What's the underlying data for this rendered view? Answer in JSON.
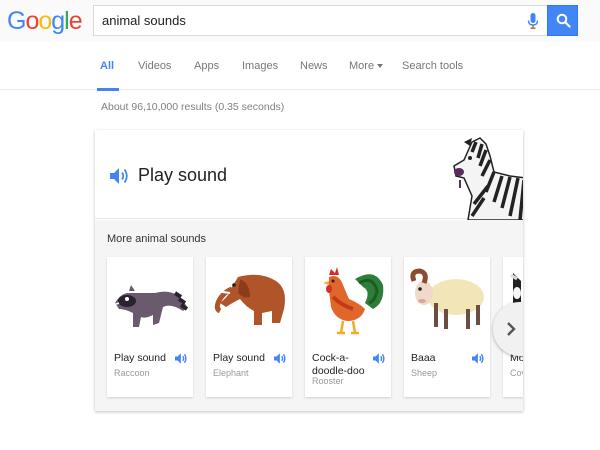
{
  "logo": {
    "letters": [
      "G",
      "o",
      "o",
      "g",
      "l",
      "e"
    ],
    "colors": [
      "#4285f4",
      "#ea4335",
      "#fbbc05",
      "#4285f4",
      "#34a853",
      "#ea4335"
    ]
  },
  "search": {
    "query": "animal sounds",
    "mic_icon": "microphone-icon",
    "button_icon": "search-icon"
  },
  "tabs": [
    {
      "label": "All",
      "active": true
    },
    {
      "label": "Videos"
    },
    {
      "label": "Apps"
    },
    {
      "label": "Images"
    },
    {
      "label": "News"
    },
    {
      "label": "More"
    },
    {
      "label": "Search tools"
    }
  ],
  "result_stats": "About 96,10,000 results (0.35 seconds)",
  "card": {
    "play_label": "Play sound",
    "speaker_icon": "speaker-icon",
    "more_title": "More animal sounds",
    "animals": [
      {
        "label": "Play sound",
        "sub": "Raccoon",
        "icon": "raccoon"
      },
      {
        "label": "Play sound",
        "sub": "Elephant",
        "icon": "elephant"
      },
      {
        "label_line1": "Cock-a-",
        "label_line2": "doodle-doo",
        "sub": "Rooster",
        "icon": "rooster"
      },
      {
        "label": "Baaa",
        "sub": "Sheep",
        "icon": "sheep"
      },
      {
        "label": "Mo",
        "sub": "Cov",
        "icon": "cow"
      }
    ],
    "next_icon": "chevron-right-icon"
  },
  "colors": {
    "accent": "#4285f4"
  }
}
